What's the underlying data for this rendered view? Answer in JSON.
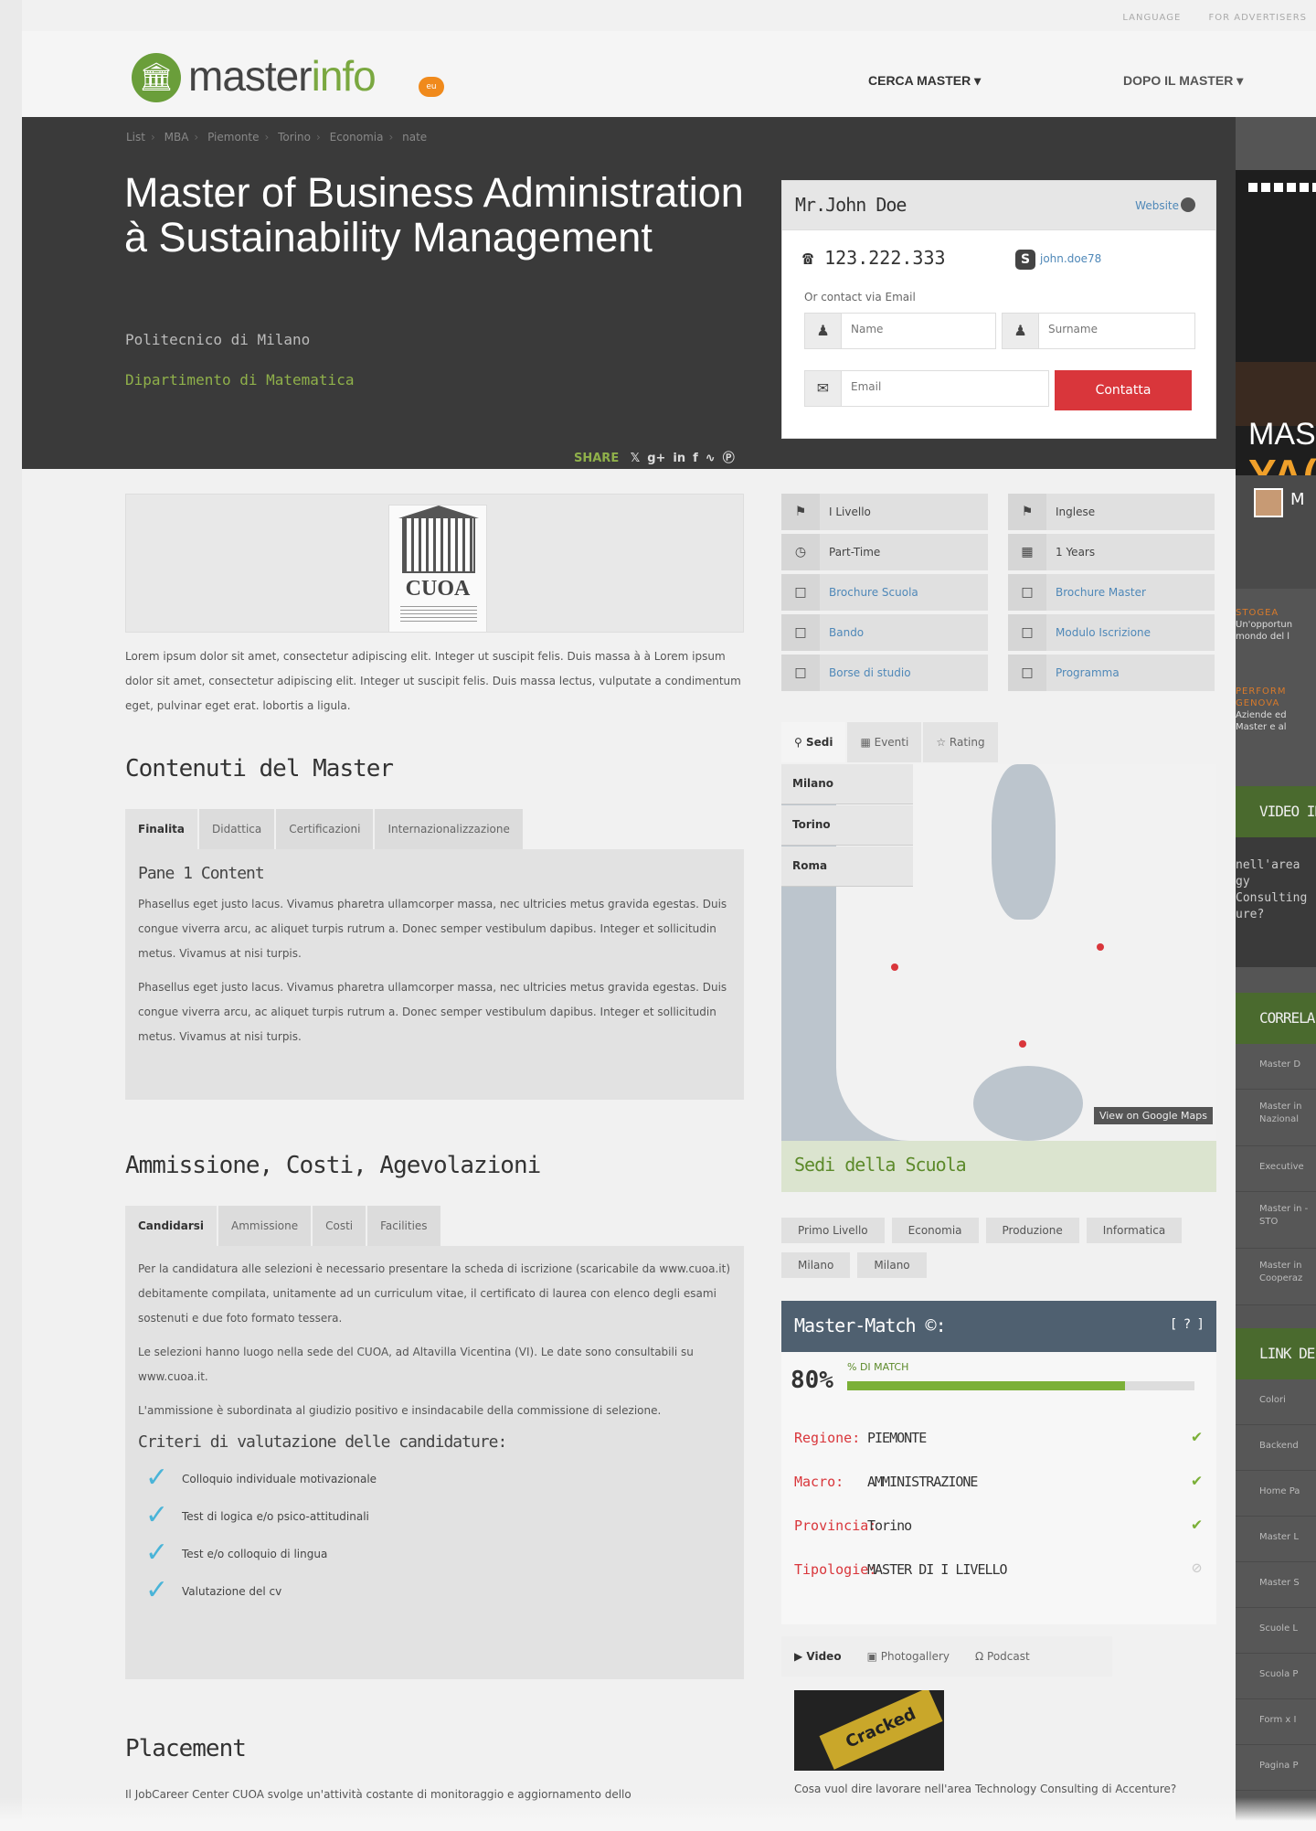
{
  "utility_nav": {
    "language": "LANGUAGE",
    "advertisers": "FOR ADVERTISERS"
  },
  "logo": {
    "text_dark": "master",
    "text_green": "info",
    "badge": "eu"
  },
  "main_nav": {
    "cerca": "CERCA MASTER ▾",
    "dopo": "DOPO IL MASTER ▾"
  },
  "breadcrumb": [
    "List",
    "MBA",
    "Piemonte",
    "Torino",
    "Economia",
    "nate"
  ],
  "hero": {
    "title": "Master of Business Administration à Sustainability Management",
    "school": "Politecnico di Milano",
    "department": "Dipartimento di Matematica",
    "share_label": "SHARE",
    "share_icons": [
      "twitter-icon",
      "google-plus-icon",
      "linkedin-icon",
      "facebook-icon",
      "rss-icon",
      "pinterest-icon"
    ]
  },
  "contact": {
    "name": "Mr.John Doe",
    "website": "Website",
    "phone": "123.222.333",
    "skype": "john.doe78",
    "via_email": "Or contact via Email",
    "name_placeholder": "Name",
    "surname_placeholder": "Surname",
    "email_placeholder": "Email",
    "submit": "Contatta"
  },
  "logo_image": {
    "name": "CUOA"
  },
  "intro": "Lorem ipsum dolor sit amet, consectetur adipiscing elit. Integer ut suscipit felis. Duis massa à à Lorem ipsum dolor sit amet, consectetur adipiscing elit. Integer ut suscipit felis. Duis massa lectus, vulputate a condimentum eget, pulvinar eget erat. lobortis a ligula.",
  "contenuti": {
    "title": "Contenuti del Master",
    "tabs": [
      "Finalita",
      "Didattica",
      "Certificazioni",
      "Internazionalizzazione"
    ],
    "pane_title": "Pane 1 Content",
    "paragraphs": [
      "Phasellus eget justo lacus. Vivamus pharetra ullamcorper massa, nec ultricies metus gravida egestas. Duis congue viverra arcu, ac aliquet turpis rutrum a. Donec semper vestibulum dapibus. Integer et sollicitudin metus. Vivamus at nisi turpis.",
      "Phasellus eget justo lacus. Vivamus pharetra ullamcorper massa, nec ultricies metus gravida egestas. Duis congue viverra arcu, ac aliquet turpis rutrum a. Donec semper vestibulum dapibus. Integer et sollicitudin metus. Vivamus at nisi turpis."
    ]
  },
  "ammissione": {
    "title": "Ammissione, Costi, Agevolazioni",
    "tabs": [
      "Candidarsi",
      "Ammissione",
      "Costi",
      "Facilities"
    ],
    "paragraphs": [
      "Per la candidatura alle selezioni è necessario presentare la scheda di iscrizione (scaricabile da www.cuoa.it) debitamente compilata, unitamente ad un curriculum vitae, il certificato di laurea con elenco degli esami sostenuti e due foto formato tessera.",
      "Le selezioni hanno luogo nella sede del CUOA, ad Altavilla Vicentina (VI). Le date sono consultabili su www.cuoa.it.",
      "L'ammissione è subordinata al giudizio positivo e insindacabile della commissione di selezione."
    ],
    "criteria_title": "Criteri di valutazione delle candidature:",
    "criteria": [
      "Colloquio individuale motivazionale",
      "Test di logica e/o psico-attitudinali",
      "Test e/o colloquio di lingua",
      "Valutazione del cv"
    ]
  },
  "placement": {
    "title": "Placement",
    "text": "Il JobCareer Center CUOA svolge un'attività costante di monitoraggio e aggiornamento dello"
  },
  "info_left": [
    {
      "icon": "tag-icon",
      "label": "I Livello",
      "link": false
    },
    {
      "icon": "clock-icon",
      "label": "Part-Time",
      "link": false
    },
    {
      "icon": "document-icon",
      "label": "Brochure Scuola",
      "link": true
    },
    {
      "icon": "document-icon",
      "label": "Bando",
      "link": true
    },
    {
      "icon": "document-icon",
      "label": "Borse di studio",
      "link": true
    }
  ],
  "info_right": [
    {
      "icon": "flag-icon",
      "label": "Inglese",
      "link": false
    },
    {
      "icon": "calendar-icon",
      "label": "1 Years",
      "link": false
    },
    {
      "icon": "document-icon",
      "label": "Brochure Master",
      "link": true
    },
    {
      "icon": "document-icon",
      "label": "Modulo Iscrizione",
      "link": true
    },
    {
      "icon": "document-icon",
      "label": "Programma",
      "link": true
    }
  ],
  "map_tabs": [
    "Sedi",
    "Eventi",
    "Rating"
  ],
  "map_cities": [
    "Milano",
    "Torino",
    "Roma"
  ],
  "map_link": "View on Google Maps",
  "sedi_title": "Sedi della Scuola",
  "tags": [
    "Primo Livello",
    "Economia",
    "Produzione",
    "Informatica",
    "Milano",
    "Milano"
  ],
  "master_match": {
    "title": "Master-Match ©:",
    "help": "[ ? ]",
    "percent": "80%",
    "label": "% DI MATCH",
    "fraction": 0.8,
    "rows": [
      {
        "key": "Regione:",
        "value": "PIEMONTE",
        "ok": true
      },
      {
        "key": "Macro:",
        "value": "AMMINISTRAZIONE",
        "ok": true
      },
      {
        "key": "Provincia:",
        "value": "Torino",
        "ok": true
      },
      {
        "key": "Tipologie:",
        "value": "MASTER DI I LIVELLO",
        "ok": false
      }
    ]
  },
  "media_tabs": [
    "Video",
    "Photogallery",
    "Podcast"
  ],
  "video": {
    "sticker": "Cracked",
    "caption": "Cosa vuol dire lavorare nell'area Technology Consulting di Accenture?"
  },
  "sidebar": {
    "ad_line1": "MAS",
    "ad_line2": "YA(",
    "profile_initial": "M",
    "promo1_label": "STOGEA",
    "promo1_text": "Un'opportun mondo del l",
    "promo2_label": "PERFORM GENOVA",
    "promo2_text": "Aziende ed Master e al",
    "video_header": "VIDEO IN",
    "video_text": "nell'area gy Consulting ure?",
    "correlati_header": "CORRELA",
    "correlati": [
      "Master D",
      "Master in Nazional",
      "Executive",
      "Master in - STO",
      "Master in Cooperaz"
    ],
    "link_header": "LINK DE",
    "links": [
      "Colori",
      "Backend",
      "Home Pa",
      "Master L",
      "Master S",
      "Scuole L",
      "Scuola P",
      "Form x I",
      "Pagina P"
    ]
  }
}
